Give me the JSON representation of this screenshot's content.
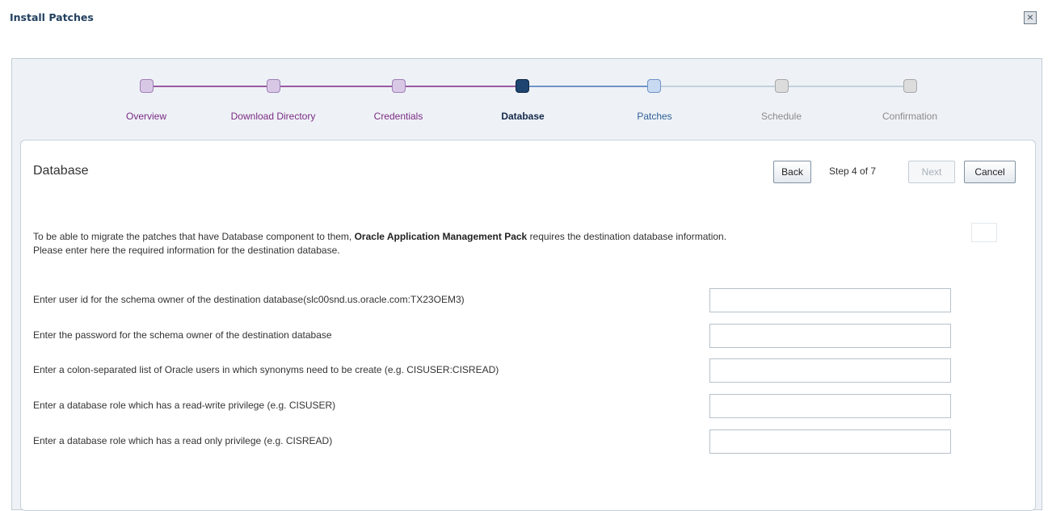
{
  "dialog": {
    "title": "Install Patches"
  },
  "train": {
    "steps": [
      {
        "label": "Overview",
        "state": "visited"
      },
      {
        "label": "Download Directory",
        "state": "visited"
      },
      {
        "label": "Credentials",
        "state": "visited"
      },
      {
        "label": "Database",
        "state": "current"
      },
      {
        "label": "Patches",
        "state": "next"
      },
      {
        "label": "Schedule",
        "state": "disabled"
      },
      {
        "label": "Confirmation",
        "state": "disabled"
      }
    ]
  },
  "panel": {
    "title": "Database",
    "back_label": "Back",
    "step_text": "Step 4 of 7",
    "next_label": "Next",
    "cancel_label": "Cancel"
  },
  "intro": {
    "line1_before": "To be able to migrate the patches that have Database component to them,",
    "line1_bold": "Oracle  Application Management Pack",
    "line1_after": "requires the destination database information.",
    "line2": "Please enter here the required information for the destination database."
  },
  "fields": [
    {
      "label": "Enter user id for the schema owner of the destination database(slc00snd.us.oracle.com:TX23OEM3)",
      "value": ""
    },
    {
      "label": "Enter the password for the schema owner of the destination database",
      "value": ""
    },
    {
      "label": "Enter a colon-separated list of Oracle users in which synonyms need to be create  (e.g. CISUSER:CISREAD)",
      "value": ""
    },
    {
      "label": "Enter a database role which has a read-write privilege (e.g. CISUSER)",
      "value": ""
    },
    {
      "label": "Enter a database role which has a read only privilege (e.g. CISREAD)",
      "value": ""
    }
  ],
  "colors": {
    "visited": "#7b2a84",
    "current": "#13284a",
    "next": "#2e5e96",
    "disabled": "#8a8a8a"
  },
  "icons": {
    "close": "close-x-icon"
  }
}
